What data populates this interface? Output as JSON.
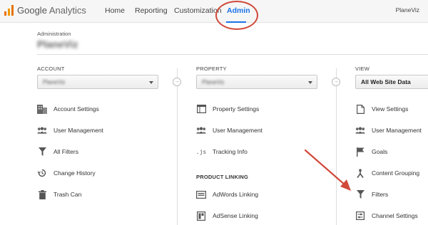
{
  "app": {
    "logo_google": "Google",
    "logo_analytics": "Analytics"
  },
  "nav": {
    "items": [
      {
        "label": "Home"
      },
      {
        "label": "Reporting"
      },
      {
        "label": "Customization"
      },
      {
        "label": "Admin",
        "active": true
      }
    ],
    "account_name": "PlaneViz"
  },
  "header": {
    "section_label": "Administration",
    "account_title": "PlaneViz"
  },
  "columns": {
    "account": {
      "heading": "ACCOUNT",
      "selected": "PlaneViz",
      "items": [
        {
          "label": "Account Settings",
          "icon": "building-icon"
        },
        {
          "label": "User Management",
          "icon": "users-icon"
        },
        {
          "label": "All Filters",
          "icon": "filter-icon"
        },
        {
          "label": "Change History",
          "icon": "history-icon"
        },
        {
          "label": "Trash Can",
          "icon": "trash-icon"
        }
      ]
    },
    "property": {
      "heading": "PROPERTY",
      "selected": "PlaneViz",
      "items": [
        {
          "label": "Property Settings",
          "icon": "window-icon"
        },
        {
          "label": "User Management",
          "icon": "users-icon"
        },
        {
          "label": "Tracking Info",
          "icon": "js-icon",
          "icon_text": ".js"
        }
      ],
      "section_heading": "PRODUCT LINKING",
      "linking_items": [
        {
          "label": "AdWords Linking",
          "icon": "adwords-icon"
        },
        {
          "label": "AdSense Linking",
          "icon": "adsense-icon"
        }
      ]
    },
    "view": {
      "heading": "VIEW",
      "selected": "All Web Site Data",
      "items": [
        {
          "label": "View Settings",
          "icon": "document-icon"
        },
        {
          "label": "User Management",
          "icon": "users-icon"
        },
        {
          "label": "Goals",
          "icon": "flag-icon"
        },
        {
          "label": "Content Grouping",
          "icon": "grouping-icon"
        },
        {
          "label": "Filters",
          "icon": "filter-icon"
        },
        {
          "label": "Channel Settings",
          "icon": "channel-icon"
        }
      ]
    }
  },
  "colors": {
    "accent": "#1a73e8",
    "annotation": "#d0493a",
    "logo_orange": "#e8710a"
  }
}
